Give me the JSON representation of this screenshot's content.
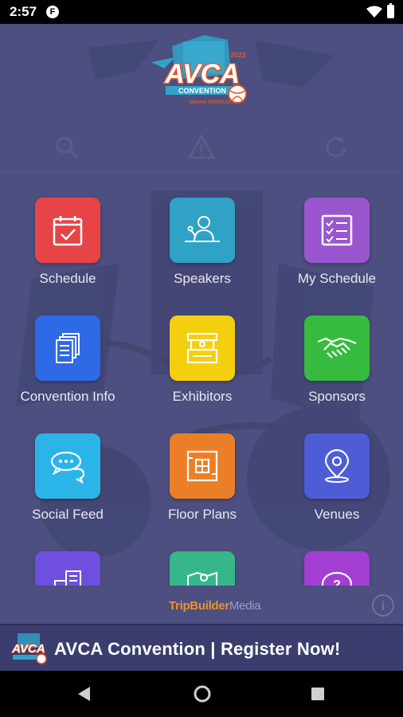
{
  "status_bar": {
    "time": "2:57",
    "app_icon_letter": "F"
  },
  "header": {
    "logo_year": "2022",
    "logo_title": "AVCA",
    "logo_subtitle": "CONVENTION",
    "logo_city": "OMAHA NEBRASKA"
  },
  "toolbar": {
    "icons": [
      "search-icon",
      "alert-icon",
      "refresh-icon"
    ]
  },
  "grid": {
    "items": [
      {
        "label": "Schedule",
        "icon": "calendar-check-icon",
        "color": "#e64446"
      },
      {
        "label": "Speakers",
        "icon": "speaker-podium-icon",
        "color": "#2fa2c5"
      },
      {
        "label": "My Schedule",
        "icon": "checklist-icon",
        "color": "#9a56cf"
      },
      {
        "label": "Convention Info",
        "icon": "documents-icon",
        "color": "#2f6ae6"
      },
      {
        "label": "Exhibitors",
        "icon": "booth-icon",
        "color": "#f4cf0e"
      },
      {
        "label": "Sponsors",
        "icon": "handshake-icon",
        "color": "#36bb3f"
      },
      {
        "label": "Social Feed",
        "icon": "chat-bubbles-icon",
        "color": "#2bb4e8"
      },
      {
        "label": "Floor Plans",
        "icon": "floor-plan-icon",
        "color": "#eb7f27"
      },
      {
        "label": "Venues",
        "icon": "map-pin-icon",
        "color": "#4e5dd6"
      },
      {
        "label": "",
        "icon": "buildings-icon",
        "color": "#6e4fe0"
      },
      {
        "label": "",
        "icon": "map-icon",
        "color": "#36b78a"
      },
      {
        "label": "",
        "icon": "help-icon",
        "color": "#a23ed2"
      }
    ]
  },
  "footer": {
    "powered_by": "",
    "brand_trip": "TripBuilder",
    "brand_media": "Media",
    "info_icon": "info-icon"
  },
  "banner": {
    "text": "AVCA Convention | Register Now!"
  },
  "nav_bar": {
    "buttons": [
      "back-icon",
      "home-icon",
      "recents-icon"
    ]
  }
}
